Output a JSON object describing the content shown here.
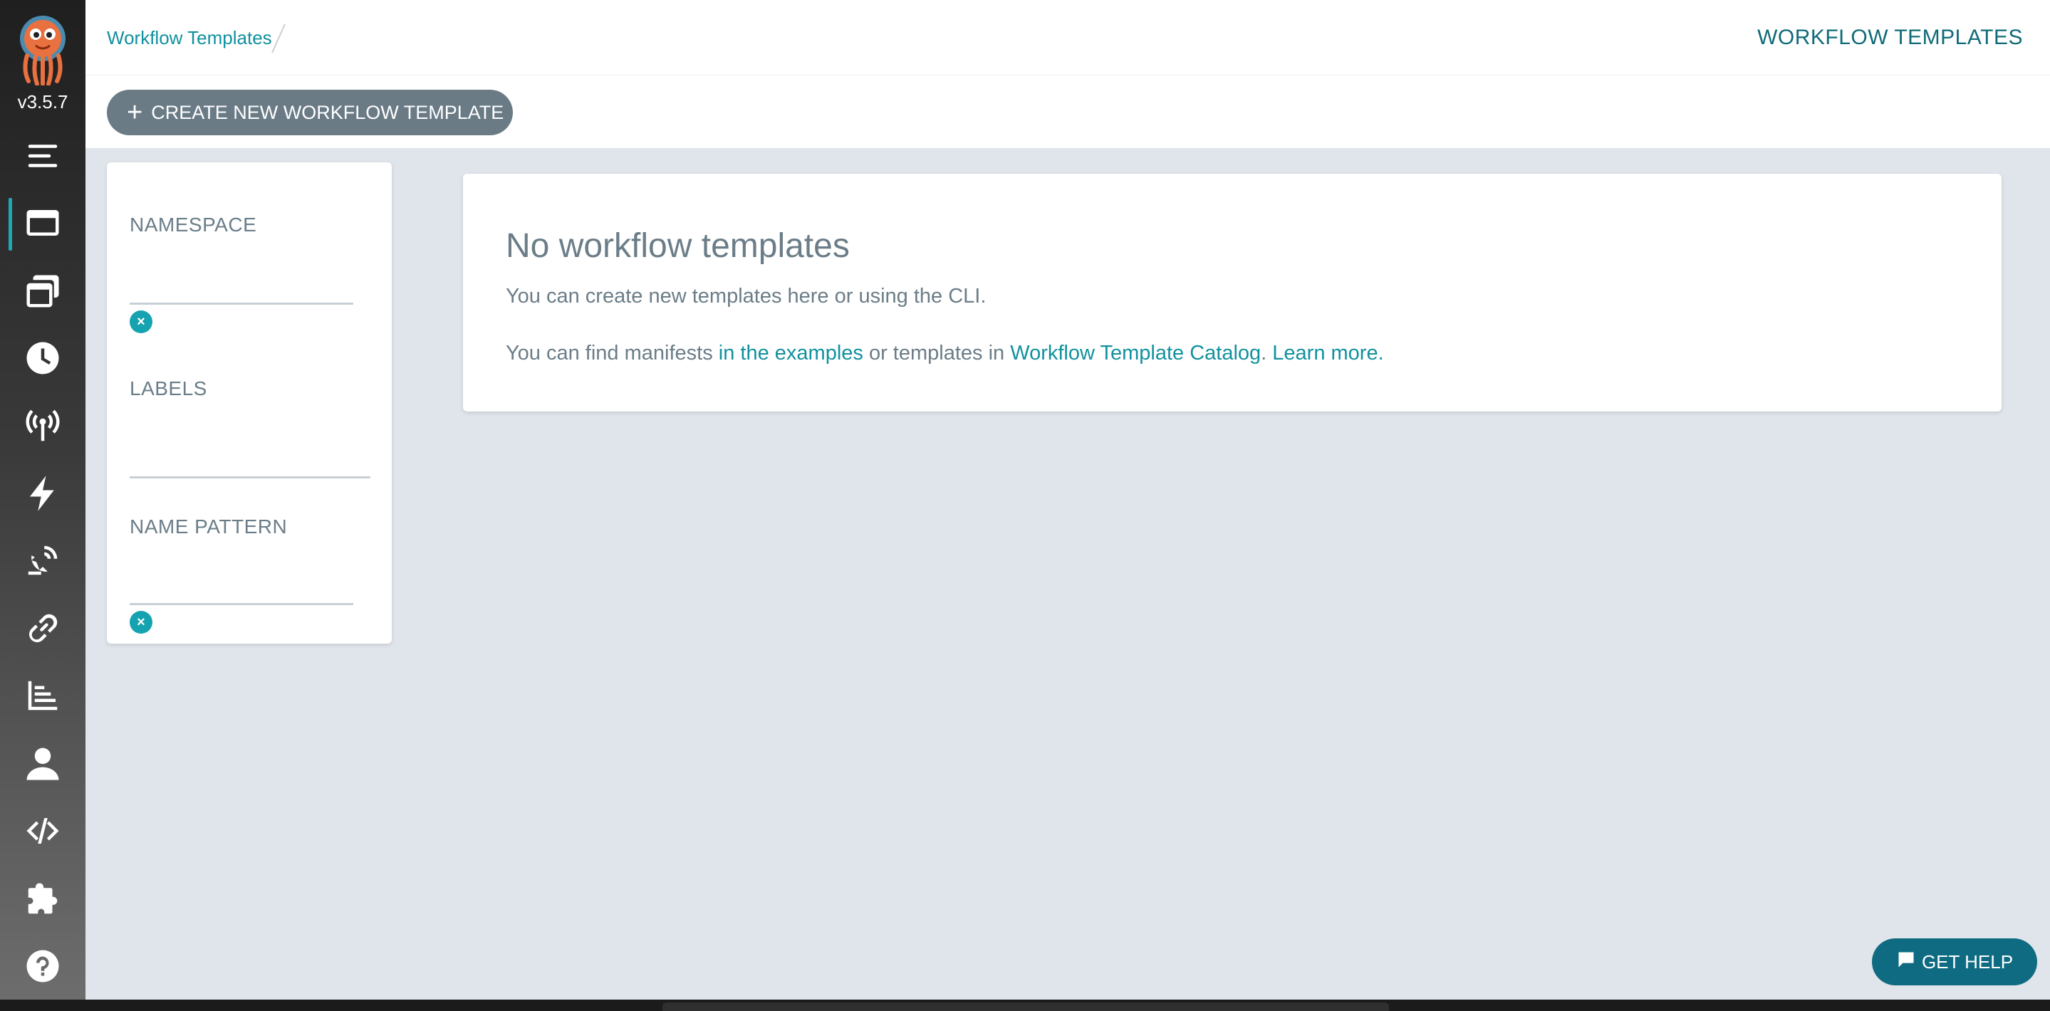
{
  "app": {
    "version": "v3.5.7",
    "logo_icon": "argo-octopus-logo-icon"
  },
  "sidebar": {
    "items": [
      {
        "name": "menu",
        "icon": "hamburger-menu-icon",
        "active": false
      },
      {
        "name": "workflows",
        "icon": "window-icon",
        "active": true
      },
      {
        "name": "workflow-templates",
        "icon": "stacked-windows-icon",
        "active": false
      },
      {
        "name": "cron-workflows",
        "icon": "clock-icon",
        "active": false
      },
      {
        "name": "event-sources",
        "icon": "broadcast-antenna-icon",
        "active": false
      },
      {
        "name": "sensors",
        "icon": "lightning-bolt-icon",
        "active": false
      },
      {
        "name": "event-flow",
        "icon": "satellite-dish-icon",
        "active": false
      },
      {
        "name": "api-docs-links",
        "icon": "link-icon",
        "active": false
      },
      {
        "name": "reports",
        "icon": "bar-chart-icon",
        "active": false
      },
      {
        "name": "user",
        "icon": "user-icon",
        "active": false
      },
      {
        "name": "api-docs",
        "icon": "code-icon",
        "active": false
      },
      {
        "name": "plugins",
        "icon": "puzzle-piece-icon",
        "active": false
      },
      {
        "name": "help",
        "icon": "question-mark-icon",
        "active": false
      }
    ]
  },
  "topbar": {
    "breadcrumb": "Workflow Templates",
    "title": "WORKFLOW TEMPLATES"
  },
  "toolbar": {
    "create_label": "CREATE NEW WORKFLOW TEMPLATE",
    "create_icon": "plus-icon"
  },
  "filters": {
    "namespace": {
      "label": "NAMESPACE",
      "value": ""
    },
    "labels": {
      "label": "LABELS",
      "value": ""
    },
    "name_pattern": {
      "label": "NAME PATTERN",
      "value": ""
    },
    "clear_icon": "times-circle-icon"
  },
  "empty_state": {
    "title": "No workflow templates",
    "line1": "You can create new templates here or using the CLI.",
    "line2_prefix": "You can find manifests ",
    "link_examples": "in the examples",
    "line2_middle": " or templates in ",
    "link_catalog": "Workflow Template Catalog",
    "line2_dot": ". ",
    "link_learn_more": "Learn more."
  },
  "help": {
    "label": "GET HELP",
    "icon": "chat-bubble-icon"
  },
  "colors": {
    "accent": "#11919f",
    "title": "#0f6b78",
    "create_button": "#6a7b86",
    "help_button": "#0f6b82",
    "content_bg": "#dfe5ea",
    "muted_text": "#6b7d88"
  }
}
